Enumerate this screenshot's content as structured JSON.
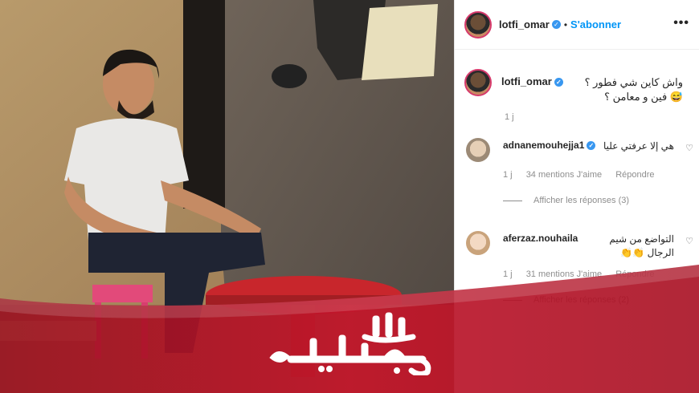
{
  "header": {
    "username": "lotfi_omar",
    "dot": "•",
    "follow_label": "S'abonner",
    "more": "•••"
  },
  "caption": {
    "username": "lotfi_omar",
    "text": "واش كاين شي فطور ؟ 😅 فين و معامن ؟",
    "time": "1 j"
  },
  "comments": [
    {
      "username": "adnanemouhejja1",
      "verified": true,
      "text": "هي إلا عرفتي عليا",
      "time": "1 j",
      "likes": "34 mentions J'aime",
      "reply": "Répondre",
      "view_replies": "Afficher les réponses (3)"
    },
    {
      "username": "aferzaz.nouhaila",
      "verified": false,
      "text": "التواضع من شيم الرجال 👏👏",
      "time": "1 j",
      "likes": "31 mentions J'aime",
      "reply": "Répondre",
      "view_replies": "Afficher les réponses (2)"
    }
  ],
  "watermark": {
    "logo_text": "لالة مولاتي"
  },
  "colors": {
    "follow": "#0095f6",
    "brand_red": "#c0142a",
    "verified": "#3897f0"
  }
}
